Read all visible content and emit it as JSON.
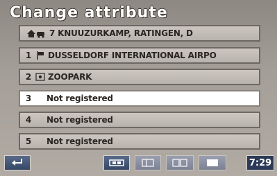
{
  "screen": {
    "title": "Change attribute"
  },
  "home": {
    "icon": "home-car-icon",
    "label": "7 KNUUZURKAMP, RATINGEN, D"
  },
  "entries": [
    {
      "num": "1",
      "icon": "flag-icon",
      "label": "DUSSELDORF INTERNATIONAL AIRPO"
    },
    {
      "num": "2",
      "icon": "map-marker-icon",
      "label": "ZOOPARK"
    },
    {
      "num": "3",
      "icon": "",
      "label": "Not registered"
    },
    {
      "num": "4",
      "icon": "",
      "label": "Not registered"
    },
    {
      "num": "5",
      "icon": "",
      "label": "Not registered"
    }
  ],
  "toolbar": {
    "back_icon": "return-arrow-icon",
    "clock": "7:29"
  }
}
